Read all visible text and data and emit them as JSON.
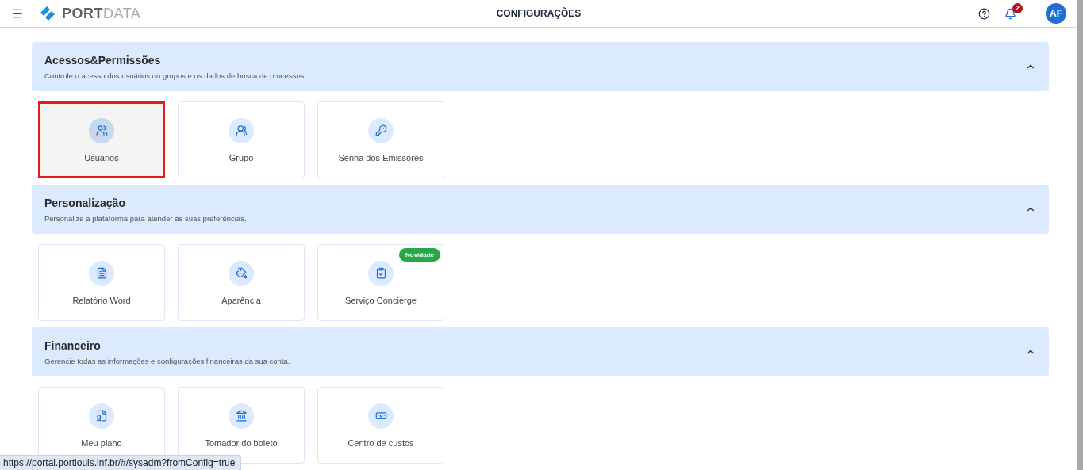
{
  "header": {
    "brand": {
      "part_1": "PORT",
      "part_2": "DATA"
    },
    "title": "CONFIGURAÇÕES",
    "notifications": "2",
    "avatar": "AF"
  },
  "sections": [
    {
      "title": "Acessos&Permissões",
      "description": "Controle o acesso dos usuários ou grupos e os dados de busca de processos.",
      "expanded": true,
      "cards": [
        {
          "label": "Usuários",
          "selected": true
        },
        {
          "label": "Grupo",
          "selected": false
        },
        {
          "label": "Senha dos Emissores",
          "selected": false
        }
      ]
    },
    {
      "title": "Personalização",
      "description": "Personalize a plataforma para atender às suas preferências.",
      "expanded": true,
      "cards": [
        {
          "label": "Relatório Word",
          "selected": false
        },
        {
          "label": "Aparência",
          "selected": false
        },
        {
          "label": "Serviço Concierge",
          "selected": false,
          "badge": "Novidade"
        }
      ]
    },
    {
      "title": "Financeiro",
      "description": "Gerencie todas as informações e configurações financeiras da sua conta.",
      "expanded": true,
      "cards": [
        {
          "label": "Meu plano",
          "selected": false
        },
        {
          "label": "Tomador do boleto",
          "selected": false
        },
        {
          "label": "Centro de custos",
          "selected": false
        }
      ]
    }
  ],
  "status_bar": {
    "url": "https://portal.portlouis.inf.br/#/sysadm?fromConfig=true"
  }
}
